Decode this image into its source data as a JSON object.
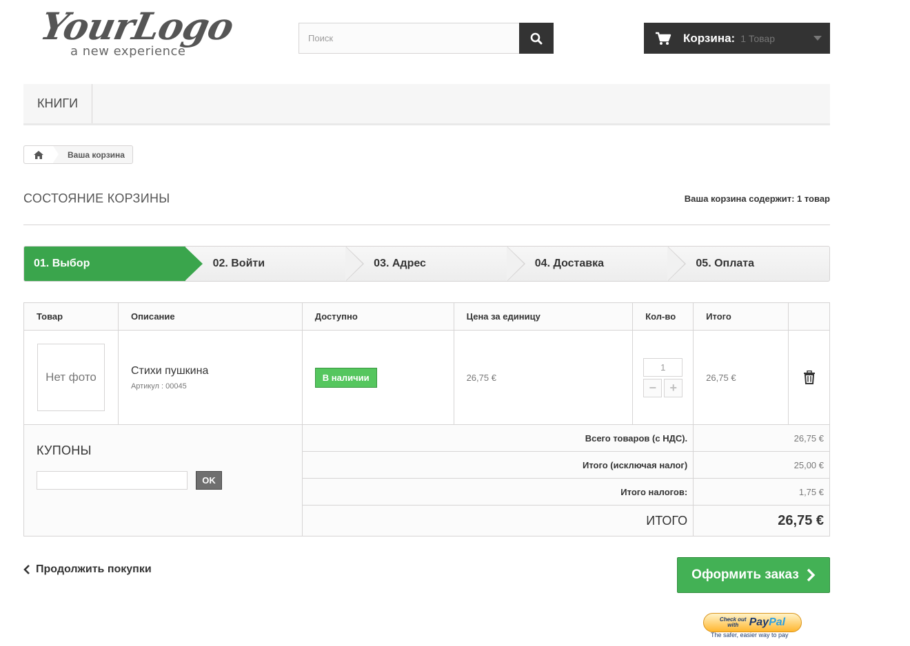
{
  "header": {
    "logo_script": "YourLogo",
    "logo_tagline": "a new experience",
    "search_placeholder": "Поиск",
    "cart_label": "Корзина:",
    "cart_count": "1 Товар"
  },
  "menu": {
    "items": [
      "Книги"
    ]
  },
  "breadcrumb": {
    "current": "Ваша корзина"
  },
  "page": {
    "title": "Состояние корзины",
    "summary": "Ваша корзина содержит: 1 товар"
  },
  "steps": [
    "01. Выбор",
    "02. Войти",
    "03. Адрес",
    "04. Доставка",
    "05. Оплата"
  ],
  "table": {
    "headers": [
      "Товар",
      "Описание",
      "Доступно",
      "Цена за единицу",
      "Кол-во",
      "Итого"
    ],
    "item": {
      "photo_text": "Нет фото",
      "name": "Стихи пушкина",
      "ref": "Артикул : 00045",
      "availability": "В наличии",
      "unit_price": "26,75 €",
      "quantity": "1",
      "total": "26,75 €"
    }
  },
  "coupons": {
    "title": "Купоны",
    "ok_label": "OK"
  },
  "totals": {
    "products_label": "Всего товаров (с НДС).",
    "products_value": "26,75 €",
    "excl_tax_label": "Итого (исключая налог)",
    "excl_tax_value": "25,00 €",
    "tax_label": "Итого налогов:",
    "tax_value": "1,75 €",
    "total_label": "Итого",
    "total_value": "26,75 €"
  },
  "actions": {
    "continue_label": "Продолжить покупки",
    "checkout_label": "Оформить заказ"
  },
  "paypal": {
    "line1": "Check out",
    "line2": "with",
    "brand_a": "Pay",
    "brand_b": "Pal",
    "tagline": "The safer, easier way to pay"
  },
  "colors": {
    "accent_green": "#3aa54c",
    "dark": "#333333"
  }
}
